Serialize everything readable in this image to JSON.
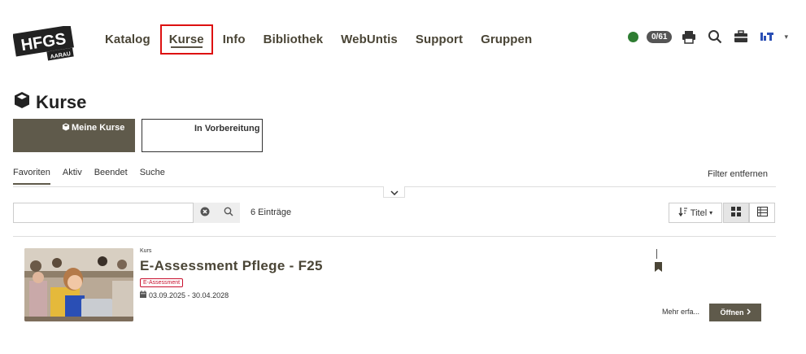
{
  "logo": {
    "title": "HFGS",
    "subtitle": "AARAU"
  },
  "nav": {
    "items": [
      {
        "label": "Katalog"
      },
      {
        "label": "Kurse"
      },
      {
        "label": "Info"
      },
      {
        "label": "Bibliothek"
      },
      {
        "label": "WebUntis"
      },
      {
        "label": "Support"
      },
      {
        "label": "Gruppen"
      }
    ],
    "active": "Kurse"
  },
  "tools": {
    "status_color": "#2e7d32",
    "counter": "0/61",
    "icons": [
      "status-dot",
      "print-icon",
      "search-icon",
      "briefcase-icon",
      "user-avatar-icon",
      "dropdown-caret-icon"
    ]
  },
  "page": {
    "title": "Kurse"
  },
  "tiles": [
    {
      "label": "Meine Kurse",
      "active": true
    },
    {
      "label": "In Vorbereitung",
      "active": false
    }
  ],
  "tabs": {
    "items": [
      {
        "label": "Favoriten"
      },
      {
        "label": "Aktiv"
      },
      {
        "label": "Beendet"
      },
      {
        "label": "Suche"
      }
    ],
    "active": "Favoriten",
    "filter_reset": "Filter entfernen"
  },
  "search": {
    "value": "",
    "placeholder": "",
    "entry_count": "6 Einträge"
  },
  "sort": {
    "label": "Titel"
  },
  "courses": [
    {
      "type": "Kurs",
      "title": "E-Assessment Pflege - F25",
      "tag": "E-Assessment",
      "dates": "03.09.2025 - 30.04.2028",
      "more_label": "Mehr erfa...",
      "open_label": "Öffnen"
    }
  ],
  "colors": {
    "accent": "#5f5a4b",
    "tag": "#c8102e",
    "highlight": "#dd1111"
  }
}
